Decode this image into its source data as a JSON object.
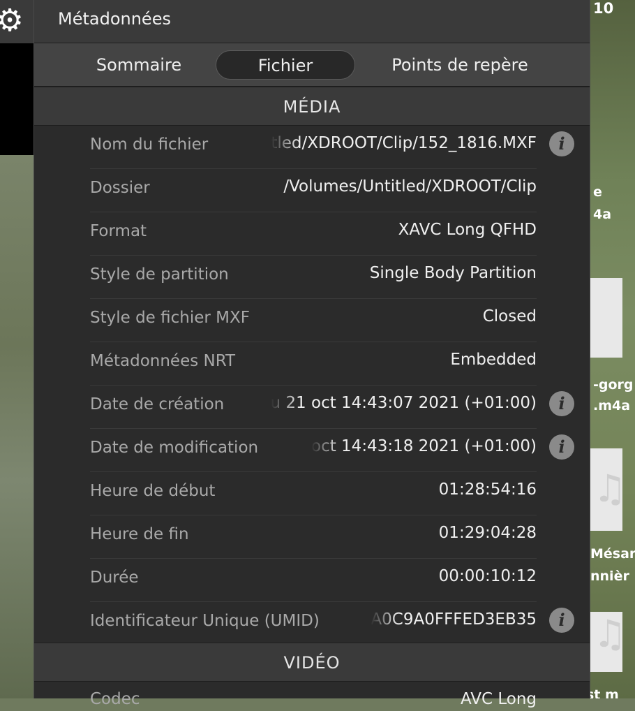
{
  "panel": {
    "title": "Métadonnées"
  },
  "tabs": [
    {
      "label": "Sommaire",
      "active": false
    },
    {
      "label": "Fichier",
      "active": true
    },
    {
      "label": "Points de repère",
      "active": false
    }
  ],
  "sections": {
    "media": {
      "title": "MÉDIA",
      "rows": [
        {
          "label": "Nom du fichier",
          "value": "tled/XDROOT/Clip/152_1816.MXF",
          "info": true
        },
        {
          "label": "Dossier",
          "value": "/Volumes/Untitled/XDROOT/Clip",
          "info": false
        },
        {
          "label": "Format",
          "value": "XAVC Long QFHD",
          "info": false
        },
        {
          "label": "Style de partition",
          "value": "Single Body Partition",
          "info": false
        },
        {
          "label": "Style de fichier MXF",
          "value": "Closed",
          "info": false
        },
        {
          "label": "Métadonnées NRT",
          "value": "Embedded",
          "info": false
        },
        {
          "label": "Date de création",
          "value": "u 21 oct 14:43:07 2021 (+01:00)",
          "info": true
        },
        {
          "label": "Date de modification",
          "value": "oct 14:43:18 2021 (+01:00)",
          "info": true
        },
        {
          "label": "Heure de début",
          "value": "01:28:54:16",
          "info": false
        },
        {
          "label": "Heure de fin",
          "value": "01:29:04:28",
          "info": false
        },
        {
          "label": "Durée",
          "value": "00:00:10:12",
          "info": false
        },
        {
          "label": "Identificateur Unique (UMID)",
          "value": "A0C9A0FFFED3EB35",
          "info": true
        }
      ]
    },
    "video": {
      "title": "VIDÉO",
      "first_row": {
        "label": "Codec",
        "value": "AVC Long"
      }
    }
  },
  "info_icon_glyph": "i",
  "background": {
    "top_text": "10",
    "label_fragments": [
      "e",
      "4a",
      "-gorg",
      ".m4a",
      "Mésar",
      "nnièr",
      "st m"
    ],
    "gear_icon": "gear-icon",
    "note_icon": "music-note-icon"
  }
}
